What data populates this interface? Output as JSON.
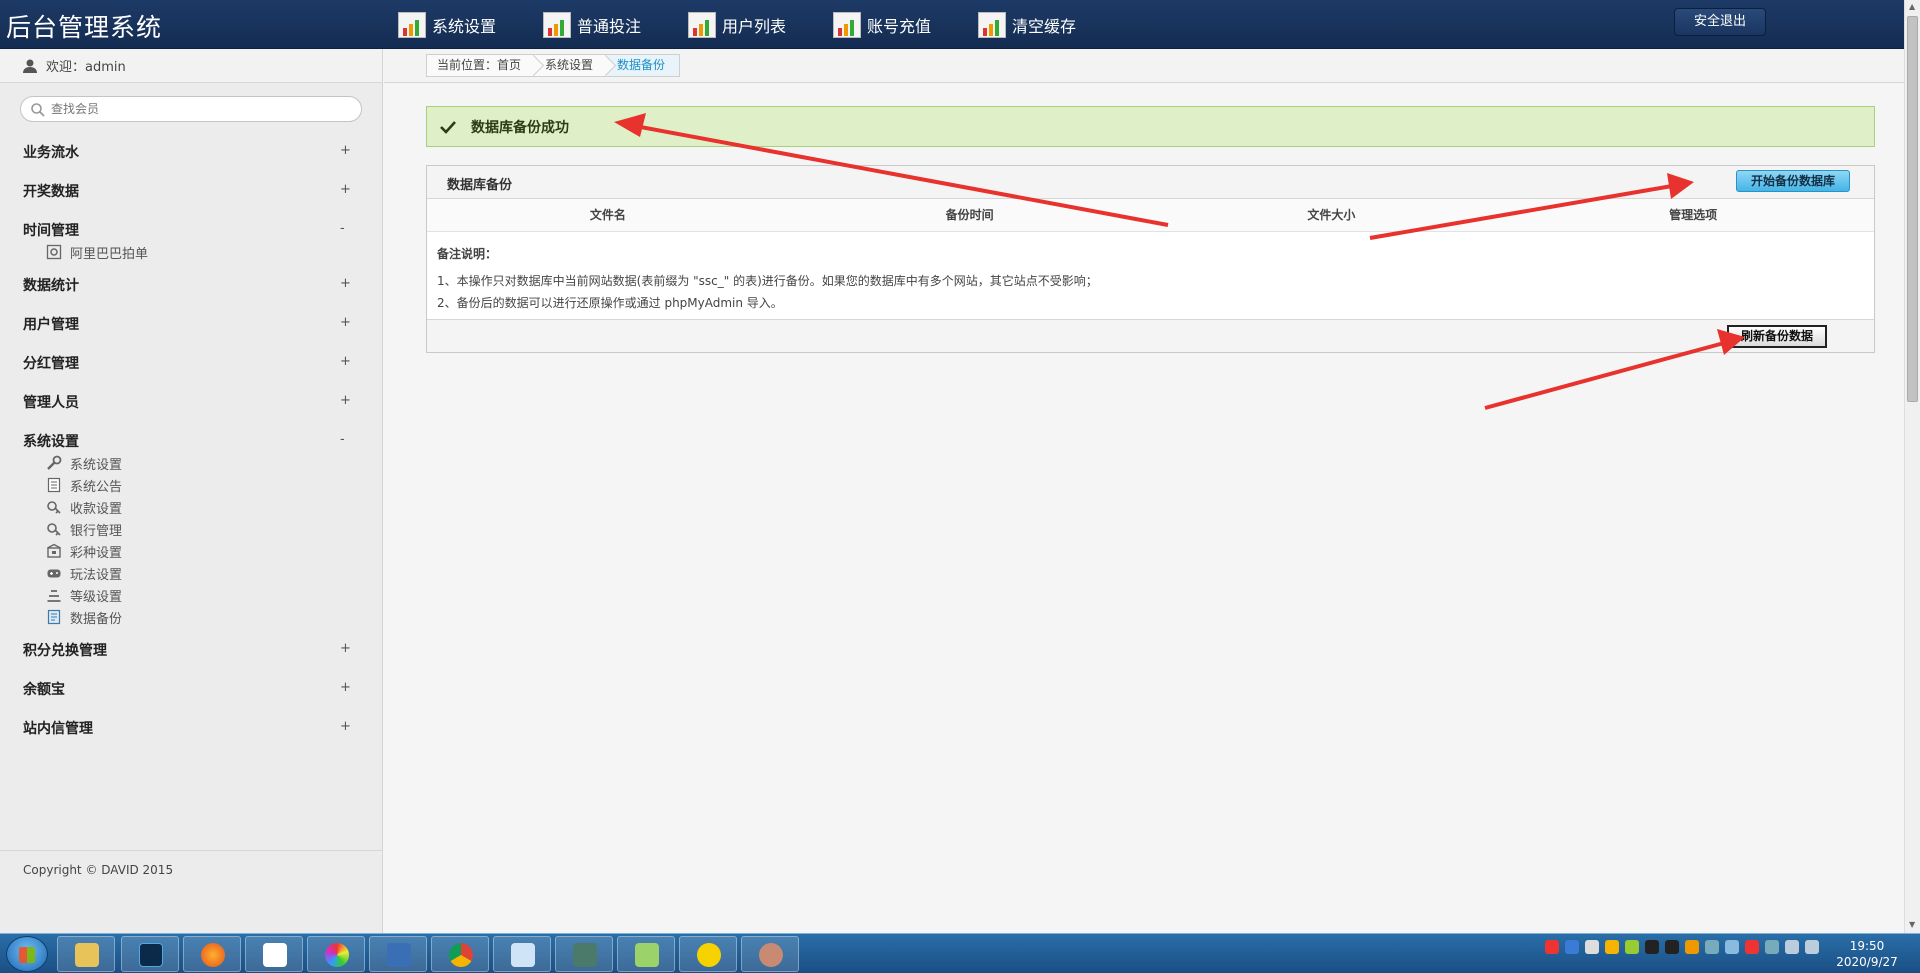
{
  "header": {
    "brand": "后台管理系统",
    "nav": [
      {
        "label": "系统设置"
      },
      {
        "label": "普通投注"
      },
      {
        "label": "用户列表"
      },
      {
        "label": "账号充值"
      },
      {
        "label": "清空缓存"
      }
    ],
    "logout_label": "安全退出"
  },
  "sidebar": {
    "welcome": "欢迎：admin",
    "search_placeholder": "查找会员",
    "groups": [
      {
        "label": "业务流水",
        "toggle": "+"
      },
      {
        "label": "开奖数据",
        "toggle": "+"
      },
      {
        "label": "时间管理",
        "toggle": "-",
        "items": [
          {
            "label": "阿里巴巴拍单",
            "icon": "gear-box-icon"
          }
        ]
      },
      {
        "label": "数据统计",
        "toggle": "+"
      },
      {
        "label": "用户管理",
        "toggle": "+"
      },
      {
        "label": "分红管理",
        "toggle": "+"
      },
      {
        "label": "管理人员",
        "toggle": "+"
      },
      {
        "label": "系统设置",
        "toggle": "-",
        "items": [
          {
            "label": "系统设置",
            "icon": "wrench-icon"
          },
          {
            "label": "系统公告",
            "icon": "document-icon"
          },
          {
            "label": "收款设置",
            "icon": "key-icon"
          },
          {
            "label": "银行管理",
            "icon": "key-icon"
          },
          {
            "label": "彩种设置",
            "icon": "box-icon"
          },
          {
            "label": "玩法设置",
            "icon": "gamepad-icon"
          },
          {
            "label": "等级设置",
            "icon": "levels-icon"
          },
          {
            "label": "数据备份",
            "icon": "database-doc-icon"
          }
        ]
      },
      {
        "label": "积分兑换管理",
        "toggle": "+"
      },
      {
        "label": "余额宝",
        "toggle": "+"
      },
      {
        "label": "站内信管理",
        "toggle": "+"
      }
    ],
    "copyright": "Copyright © DAVID 2015"
  },
  "breadcrumb": [
    "当前位置：首页",
    "系统设置",
    "数据备份"
  ],
  "alert": {
    "text": "数据库备份成功",
    "color": "#dff0c8"
  },
  "panel": {
    "title": "数据库备份",
    "start_button": "开始备份数据库",
    "columns": [
      "文件名",
      "备份时间",
      "文件大小",
      "管理选项"
    ],
    "notes_title": "备注说明：",
    "notes": [
      "1、本操作只对数据库中当前网站数据(表前缀为 \"ssc_\" 的表)进行备份。如果您的数据库中有多个网站，其它站点不受影响；",
      "2、备份后的数据可以进行还原操作或通过 phpMyAdmin 导入。"
    ],
    "refresh_button": "刷新备份数据"
  },
  "taskbar": {
    "apps": [
      "explorer-icon",
      "photoshop-icon",
      "firefox-icon",
      "baidu-netdisk-icon",
      "color-app-icon",
      "network-tool-icon",
      "chrome-icon",
      "notepad-icon",
      "terminal-app-icon",
      "notepad-plus-plus-icon",
      "qq-music-icon",
      "avatar-app-icon"
    ],
    "time": "19:50",
    "date": "2020/9/27"
  },
  "colors": {
    "header": "#1d3a66",
    "accent": "#1a8fc9",
    "arrow": "#e8322d"
  }
}
